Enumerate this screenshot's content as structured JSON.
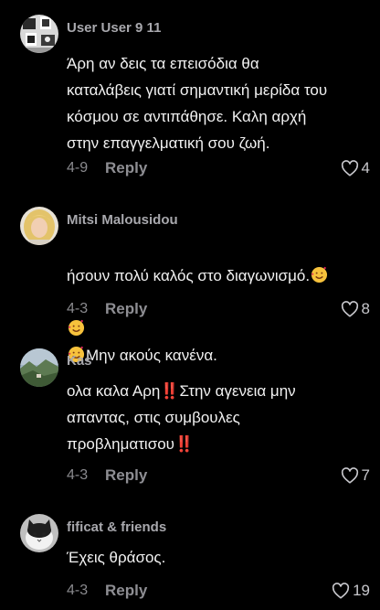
{
  "comments": [
    {
      "user": "User User 9 11",
      "text": "Άρη αν δεις τα επεισόδια θα\nκαταλάβεις γιατί σημαντική μερίδα του\nκόσμου σε αντιπάθησε. Καλη αρχή\nστην επαγγελματική σου ζωή.",
      "date": "4-9",
      "reply": "Reply",
      "likes": "4",
      "avatar_icon": "collage-photo-avatar"
    },
    {
      "user": "Mitsi Malousidou",
      "text_line1": "ήσουν πολύ καλός στο διαγωνισμό.",
      "text_line2": "Μην ακούς κανένα.",
      "date": "4-3",
      "reply": "Reply",
      "likes": "8",
      "avatar_icon": "blonde-woman-avatar",
      "emoji": "smiling-face-with-hearts"
    },
    {
      "user": "Kas",
      "text": "ολα καλα Αρη‼️Στην αγενεια μην\nαπαντας, στις συμβουλες\nπροβληματισου‼️",
      "date": "4-3",
      "reply": "Reply",
      "likes": "7",
      "avatar_icon": "landscape-avatar"
    },
    {
      "user": "fificat & friends",
      "text": "Έχεις θράσος.",
      "date": "4-3",
      "reply": "Reply",
      "likes": "19",
      "avatar_icon": "cat-avatar"
    }
  ],
  "colors": {
    "background": "#000000",
    "username": "#a8a8ad",
    "text": "#f1f1f1",
    "meta": "#8a8a8e"
  }
}
